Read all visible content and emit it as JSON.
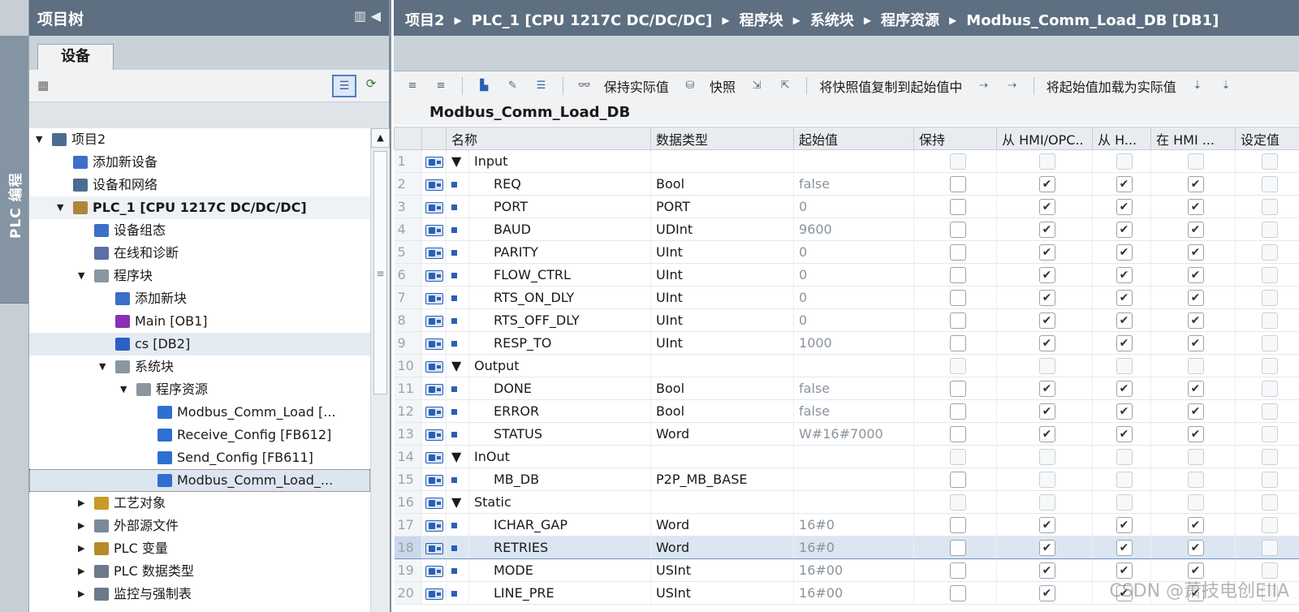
{
  "sidebar": {
    "vertical_tab": "PLC 编程"
  },
  "tree": {
    "title": "项目树",
    "tab": "设备",
    "items": [
      {
        "label": "项目2",
        "level": 0,
        "arrow": "▼"
      },
      {
        "label": "添加新设备",
        "level": 1,
        "arrow": ""
      },
      {
        "label": "设备和网络",
        "level": 1,
        "arrow": ""
      },
      {
        "label": "PLC_1 [CPU 1217C DC/DC/DC]",
        "level": 1,
        "arrow": "▼"
      },
      {
        "label": "设备组态",
        "level": 2,
        "arrow": ""
      },
      {
        "label": "在线和诊断",
        "level": 2,
        "arrow": ""
      },
      {
        "label": "程序块",
        "level": 2,
        "arrow": "▼"
      },
      {
        "label": "添加新块",
        "level": 3,
        "arrow": ""
      },
      {
        "label": "Main [OB1]",
        "level": 3,
        "arrow": ""
      },
      {
        "label": "cs [DB2]",
        "level": 3,
        "arrow": ""
      },
      {
        "label": "系统块",
        "level": 3,
        "arrow": "▼"
      },
      {
        "label": "程序资源",
        "level": 4,
        "arrow": "▼"
      },
      {
        "label": "Modbus_Comm_Load [...",
        "level": 5,
        "arrow": ""
      },
      {
        "label": "Receive_Config [FB612]",
        "level": 5,
        "arrow": ""
      },
      {
        "label": "Send_Config [FB611]",
        "level": 5,
        "arrow": ""
      },
      {
        "label": "Modbus_Comm_Load_...",
        "level": 5,
        "arrow": ""
      },
      {
        "label": "工艺对象",
        "level": 2,
        "arrow": "▶"
      },
      {
        "label": "外部源文件",
        "level": 2,
        "arrow": "▶"
      },
      {
        "label": "PLC 变量",
        "level": 2,
        "arrow": "▶"
      },
      {
        "label": "PLC 数据类型",
        "level": 2,
        "arrow": "▶"
      },
      {
        "label": "监控与强制表",
        "level": 2,
        "arrow": "▶"
      }
    ]
  },
  "breadcrumb": [
    "项目2",
    "PLC_1 [CPU 1217C DC/DC/DC]",
    "程序块",
    "系统块",
    "程序资源",
    "Modbus_Comm_Load_DB [DB1]"
  ],
  "toolbar": {
    "keep_actual": "保持实际值",
    "snapshot": "快照",
    "copy_snapshot": "将快照值复制到起始值中",
    "load_start": "将起始值加载为实际值"
  },
  "db_title": "Modbus_Comm_Load_DB",
  "columns": [
    "名称",
    "数据类型",
    "起始值",
    "保持",
    "从 HMI/OPC..",
    "从 H...",
    "在 HMI ...",
    "设定值"
  ],
  "rows": [
    {
      "no": "1",
      "exp": "▼",
      "name": "Input",
      "type": "",
      "start": "",
      "kind": "section",
      "c": [
        false,
        false,
        false,
        false
      ]
    },
    {
      "no": "2",
      "exp": "",
      "name": "REQ",
      "type": "Bool",
      "start": "false",
      "kind": "item",
      "c": [
        false,
        true,
        true,
        true
      ]
    },
    {
      "no": "3",
      "exp": "",
      "name": "PORT",
      "type": "PORT",
      "start": "0",
      "kind": "item",
      "c": [
        false,
        true,
        true,
        true
      ]
    },
    {
      "no": "4",
      "exp": "",
      "name": "BAUD",
      "type": "UDInt",
      "start": "9600",
      "kind": "item",
      "c": [
        false,
        true,
        true,
        true
      ]
    },
    {
      "no": "5",
      "exp": "",
      "name": "PARITY",
      "type": "UInt",
      "start": "0",
      "kind": "item",
      "c": [
        false,
        true,
        true,
        true
      ]
    },
    {
      "no": "6",
      "exp": "",
      "name": "FLOW_CTRL",
      "type": "UInt",
      "start": "0",
      "kind": "item",
      "c": [
        false,
        true,
        true,
        true
      ]
    },
    {
      "no": "7",
      "exp": "",
      "name": "RTS_ON_DLY",
      "type": "UInt",
      "start": "0",
      "kind": "item",
      "c": [
        false,
        true,
        true,
        true
      ]
    },
    {
      "no": "8",
      "exp": "",
      "name": "RTS_OFF_DLY",
      "type": "UInt",
      "start": "0",
      "kind": "item",
      "c": [
        false,
        true,
        true,
        true
      ]
    },
    {
      "no": "9",
      "exp": "",
      "name": "RESP_TO",
      "type": "UInt",
      "start": "1000",
      "kind": "item",
      "c": [
        false,
        true,
        true,
        true
      ]
    },
    {
      "no": "10",
      "exp": "▼",
      "name": "Output",
      "type": "",
      "start": "",
      "kind": "section",
      "c": [
        false,
        false,
        false,
        false
      ]
    },
    {
      "no": "11",
      "exp": "",
      "name": "DONE",
      "type": "Bool",
      "start": "false",
      "kind": "item",
      "c": [
        false,
        true,
        true,
        true
      ]
    },
    {
      "no": "12",
      "exp": "",
      "name": "ERROR",
      "type": "Bool",
      "start": "false",
      "kind": "item",
      "c": [
        false,
        true,
        true,
        true
      ]
    },
    {
      "no": "13",
      "exp": "",
      "name": "STATUS",
      "type": "Word",
      "start": "W#16#7000",
      "kind": "item",
      "c": [
        false,
        true,
        true,
        true
      ]
    },
    {
      "no": "14",
      "exp": "▼",
      "name": "InOut",
      "type": "",
      "start": "",
      "kind": "section",
      "c": [
        false,
        false,
        false,
        false
      ]
    },
    {
      "no": "15",
      "exp": "",
      "name": "MB_DB",
      "type": "P2P_MB_BASE",
      "start": "",
      "kind": "item",
      "c": [
        false,
        false,
        false,
        false
      ]
    },
    {
      "no": "16",
      "exp": "▼",
      "name": "Static",
      "type": "",
      "start": "",
      "kind": "section",
      "c": [
        false,
        false,
        false,
        false
      ]
    },
    {
      "no": "17",
      "exp": "",
      "name": "ICHAR_GAP",
      "type": "Word",
      "start": "16#0",
      "kind": "item",
      "c": [
        false,
        true,
        true,
        true
      ]
    },
    {
      "no": "18",
      "exp": "",
      "name": "RETRIES",
      "type": "Word",
      "start": "16#0",
      "kind": "item",
      "c": [
        false,
        true,
        true,
        true
      ],
      "selected": true
    },
    {
      "no": "19",
      "exp": "",
      "name": "MODE",
      "type": "USInt",
      "start": "16#00",
      "kind": "item",
      "c": [
        false,
        true,
        true,
        true
      ]
    },
    {
      "no": "20",
      "exp": "",
      "name": "LINE_PRE",
      "type": "USInt",
      "start": "16#00",
      "kind": "item",
      "c": [
        false,
        true,
        true,
        true
      ]
    }
  ],
  "watermark": "CSDN @萧技电创EIIA",
  "colors": {
    "title_bar": "#5d6f80",
    "selected_row": "#dce6f2",
    "accent_blue": "#2b5fb3"
  }
}
